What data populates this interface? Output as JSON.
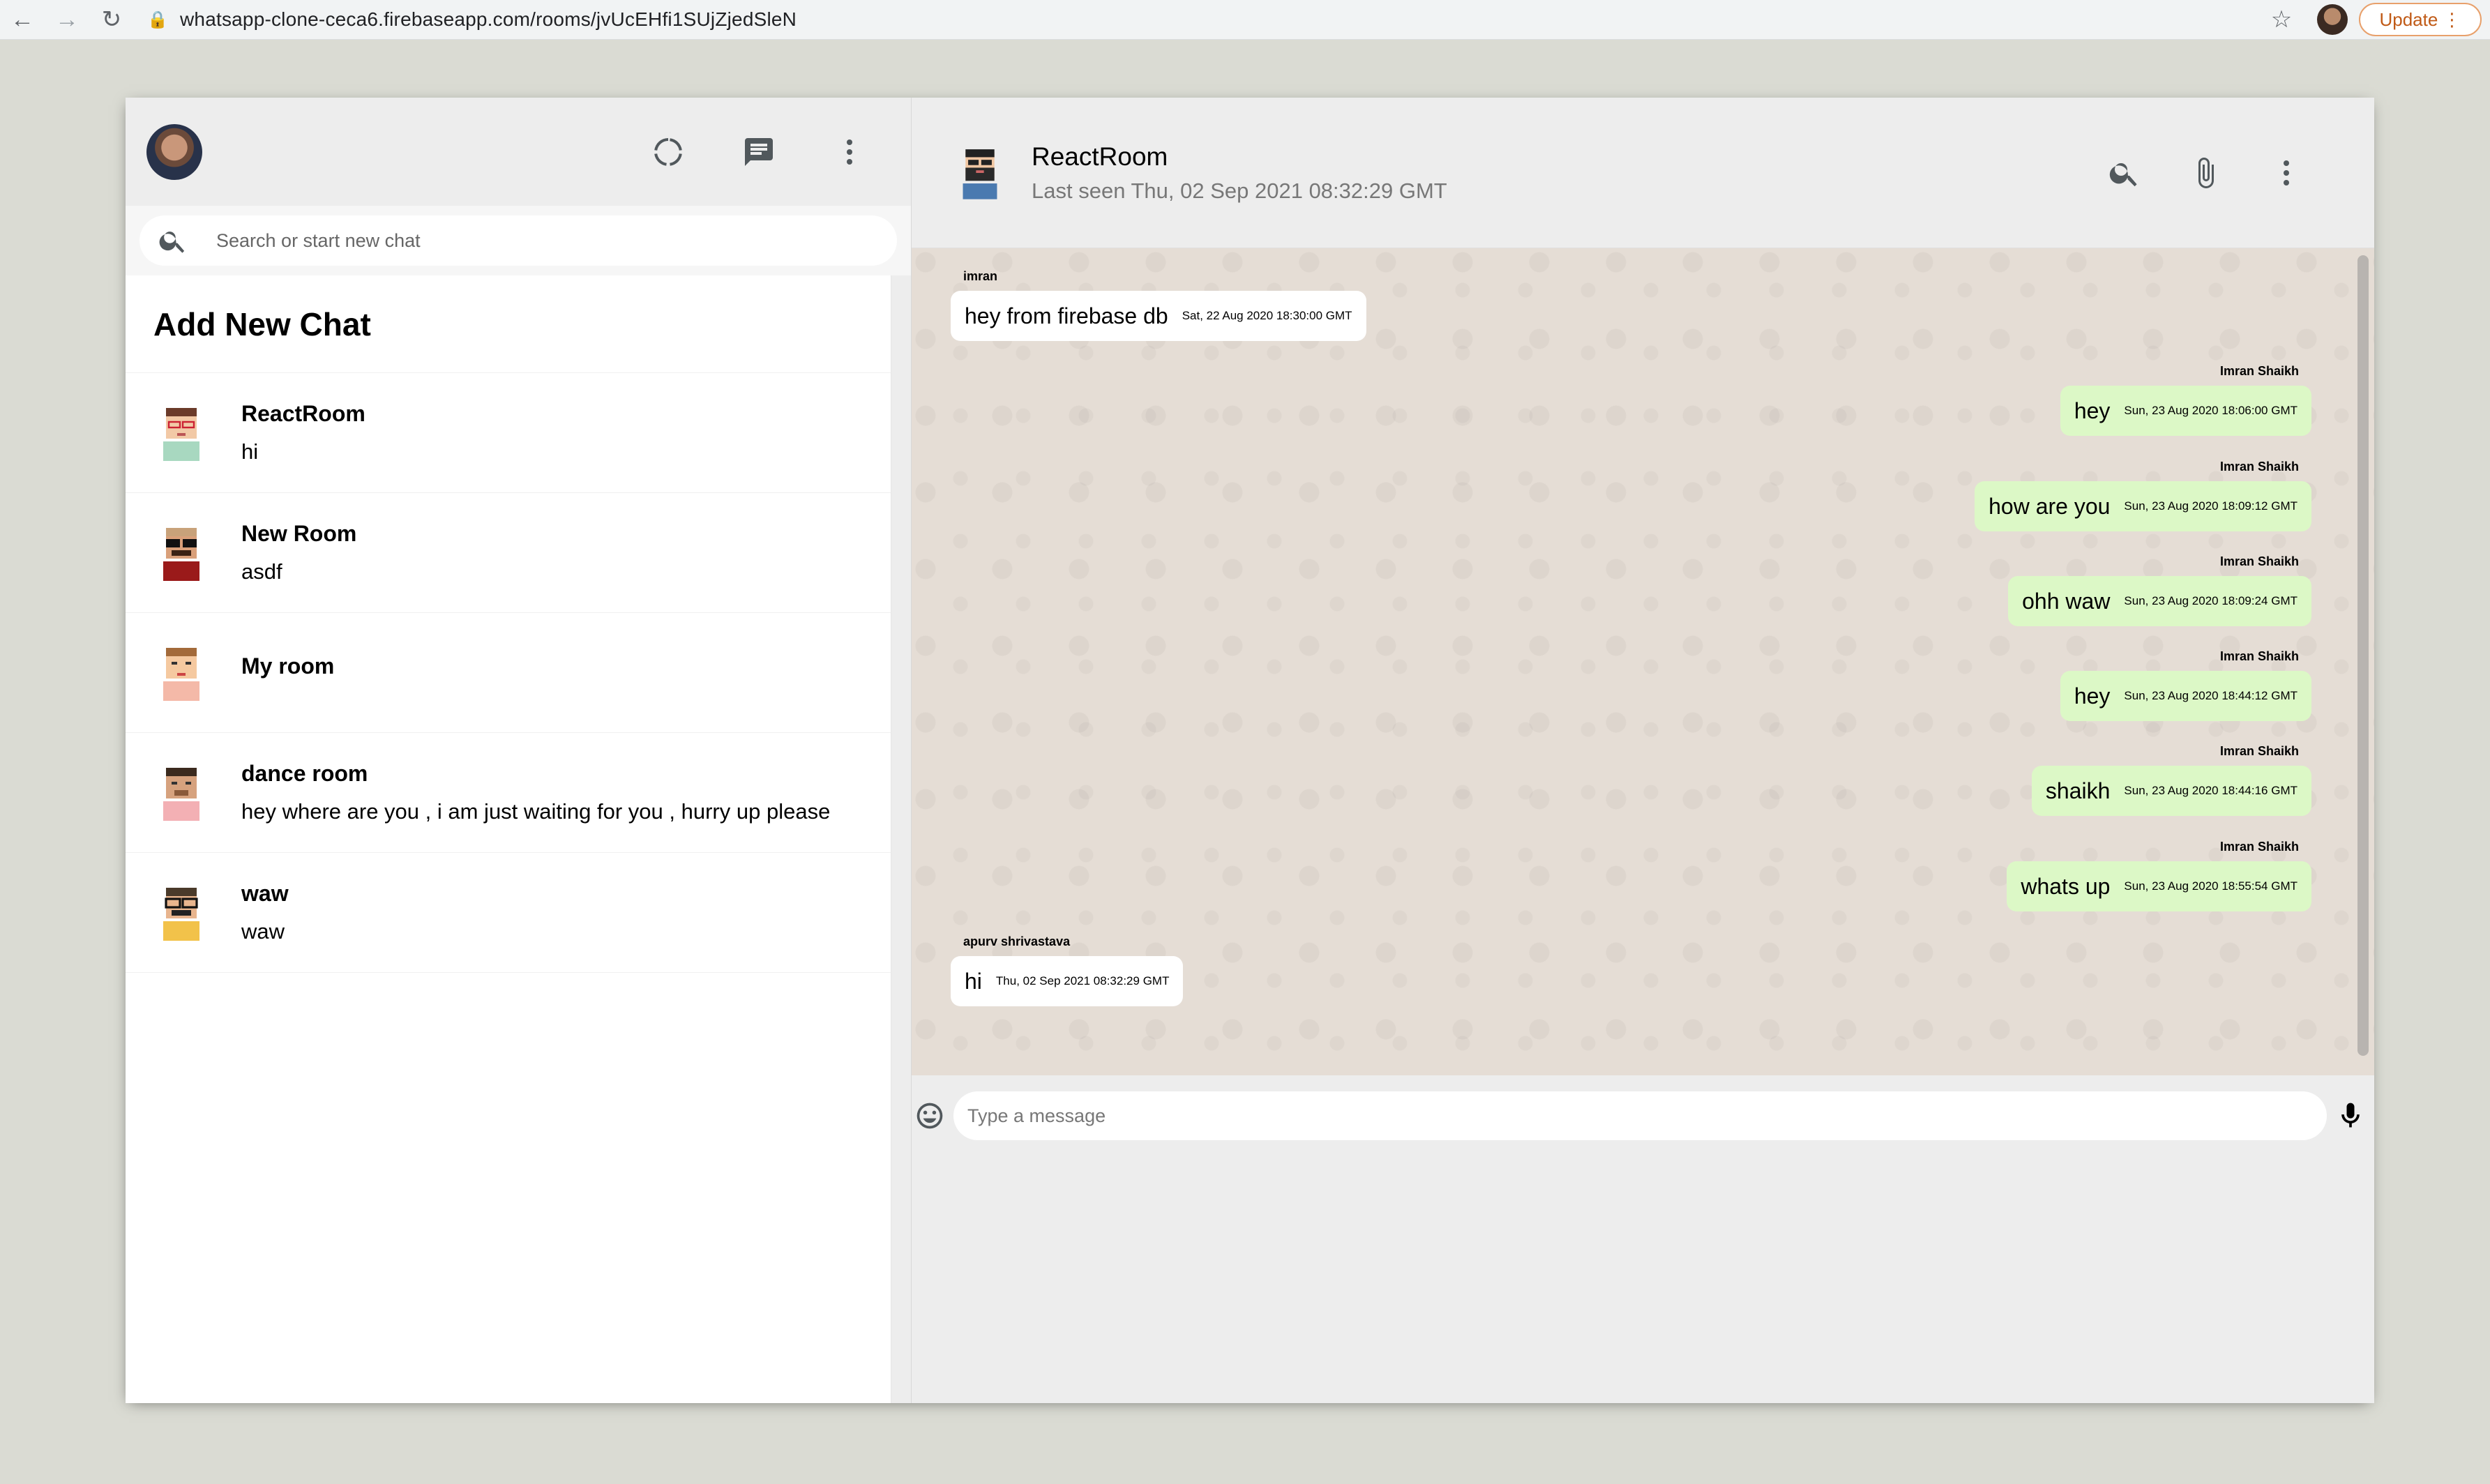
{
  "browser": {
    "back_icon": "arrow-left-icon",
    "forward_icon": "arrow-right-icon",
    "reload_icon": "reload-icon",
    "url": "whatsapp-clone-ceca6.firebaseapp.com/rooms/jvUcEHfi1SUjZjedSleN",
    "update_label": "Update"
  },
  "sidebar": {
    "search_placeholder": "Search or start new chat",
    "add_new_chat": "Add New Chat",
    "chats": [
      {
        "name": "ReactRoom",
        "last": "hi"
      },
      {
        "name": "New Room",
        "last": "asdf"
      },
      {
        "name": "My room",
        "last": ""
      },
      {
        "name": "dance room",
        "last": "hey where are you , i am just waiting for you , hurry up please"
      },
      {
        "name": "waw",
        "last": "waw"
      }
    ]
  },
  "chat": {
    "room_name": "ReactRoom",
    "last_seen": "Last seen Thu, 02 Sep 2021 08:32:29 GMT",
    "input_placeholder": "Type a message",
    "messages": [
      {
        "sender": "imran",
        "text": "hey from firebase db",
        "time": "Sat, 22 Aug 2020 18:30:00 GMT",
        "mine": false
      },
      {
        "sender": "Imran Shaikh",
        "text": "hey",
        "time": "Sun, 23 Aug 2020 18:06:00 GMT",
        "mine": true
      },
      {
        "sender": "Imran Shaikh",
        "text": "how are you",
        "time": "Sun, 23 Aug 2020 18:09:12 GMT",
        "mine": true
      },
      {
        "sender": "Imran Shaikh",
        "text": "ohh waw",
        "time": "Sun, 23 Aug 2020 18:09:24 GMT",
        "mine": true
      },
      {
        "sender": "Imran Shaikh",
        "text": "hey",
        "time": "Sun, 23 Aug 2020 18:44:12 GMT",
        "mine": true
      },
      {
        "sender": "Imran Shaikh",
        "text": "shaikh",
        "time": "Sun, 23 Aug 2020 18:44:16 GMT",
        "mine": true
      },
      {
        "sender": "Imran Shaikh",
        "text": "whats up",
        "time": "Sun, 23 Aug 2020 18:55:54 GMT",
        "mine": true
      },
      {
        "sender": "apurv shrivastava",
        "text": "hi",
        "time": "Thu, 02 Sep 2021 08:32:29 GMT",
        "mine": false
      }
    ]
  },
  "colors": {
    "background": "#dadbd3",
    "sent_bubble": "#dcf8c6",
    "received_bubble": "#ffffff"
  }
}
